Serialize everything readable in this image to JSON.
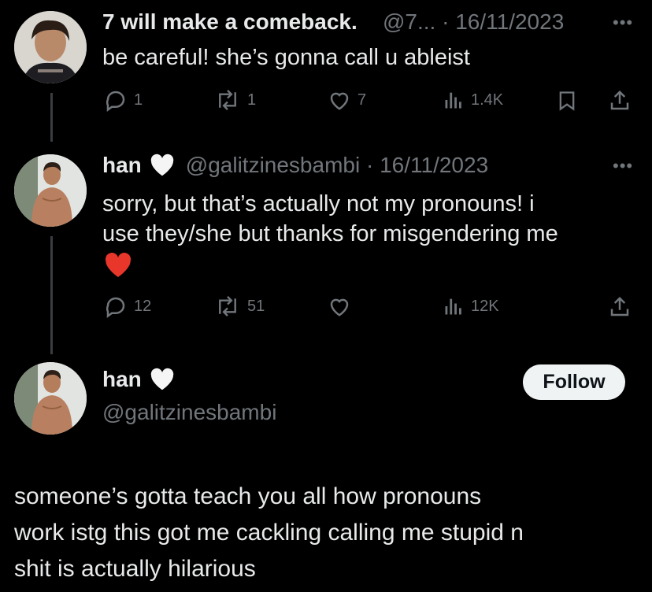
{
  "tweets": [
    {
      "display_name": "7 will make a comeback.",
      "handle_date": "@7... · 16/11/2023",
      "text": "be careful! she’s gonna call u ableist",
      "replies": "1",
      "reposts": "1",
      "likes": "7",
      "views": "1.4K"
    },
    {
      "display_name": "han",
      "handle_date": "@galitzinesbambi · 16/11/2023",
      "text_line1": "sorry, but that’s actually not my pronouns! i",
      "text_line2": "use they/she but thanks for misgendering me",
      "replies": "12",
      "reposts": "51",
      "likes": "",
      "views": "12K"
    }
  ],
  "main_tweet": {
    "display_name": "han",
    "handle": "@galitzinesbambi",
    "follow_label": "Follow",
    "text_line1": "someone’s gotta teach you all how pronouns",
    "text_line2": "work istg this got me cackling calling me stupid n",
    "text_line3": "shit is actually hilarious"
  },
  "icons": [
    "reply-icon",
    "repost-icon",
    "like-icon",
    "views-icon",
    "bookmark-icon",
    "share-icon",
    "white-heart-icon",
    "red-heart-icon",
    "more-icon"
  ],
  "colors": {
    "background": "#000000",
    "text": "#e7e9ea",
    "muted": "#71767b",
    "button": "#eff3f4",
    "red_heart": "#e8362b"
  }
}
